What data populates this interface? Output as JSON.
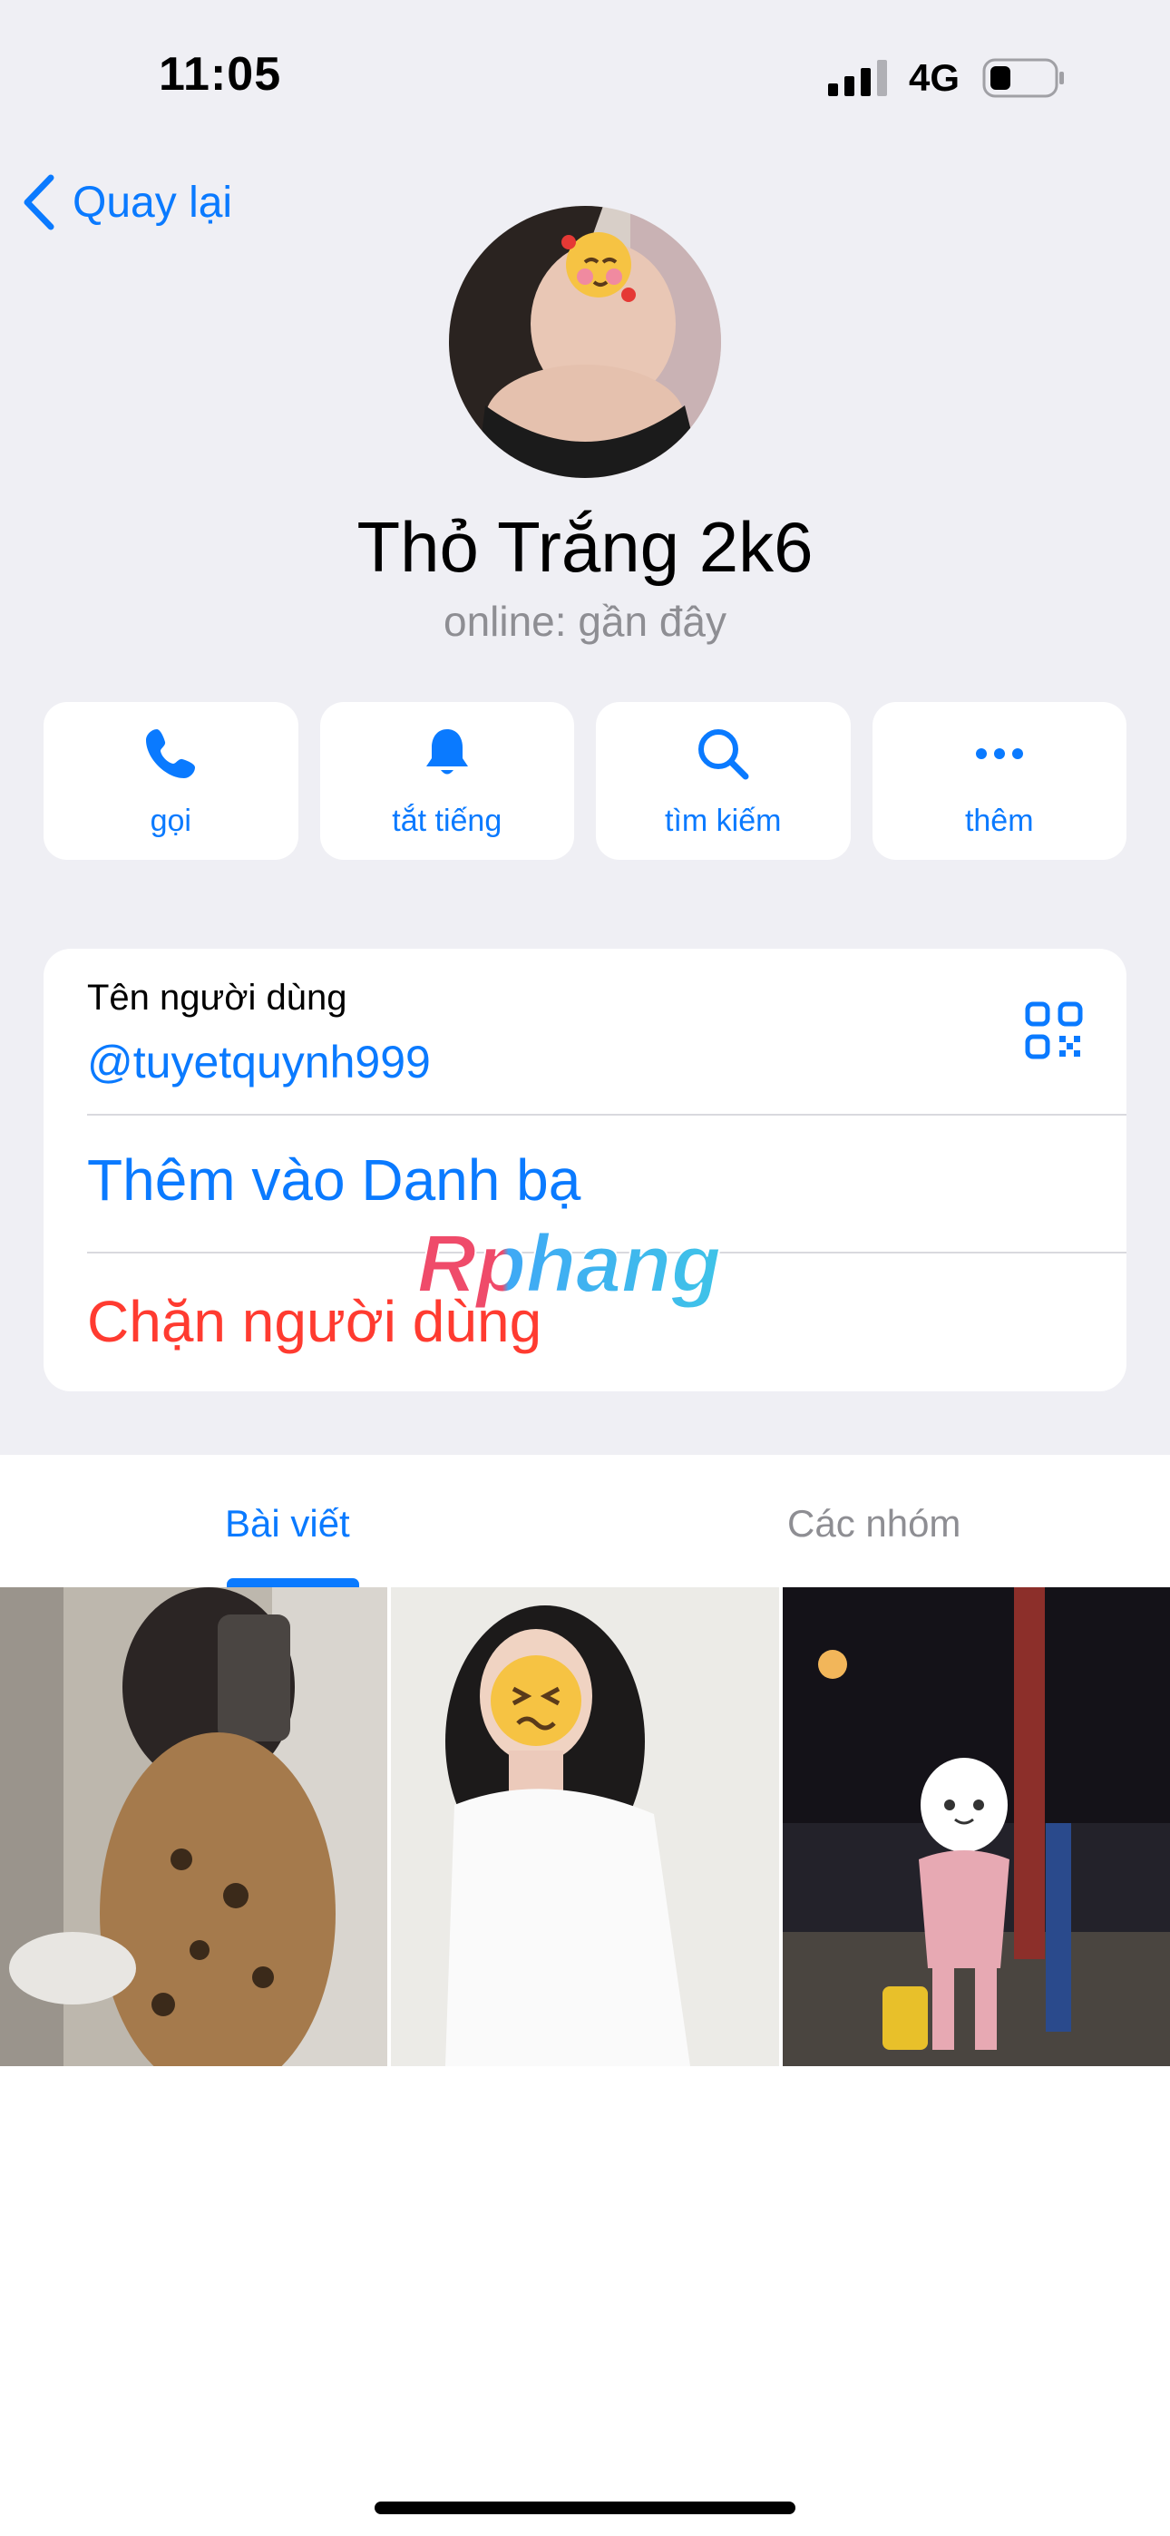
{
  "status_bar": {
    "time": "11:05",
    "network": "4G"
  },
  "nav": {
    "back_label": "Quay lại"
  },
  "profile": {
    "name": "Thỏ Trắng 2k6",
    "presence": "online: gần đây"
  },
  "actions": [
    {
      "label": "gọi",
      "icon": "phone-icon"
    },
    {
      "label": "tắt tiếng",
      "icon": "bell-icon"
    },
    {
      "label": "tìm kiếm",
      "icon": "search-icon"
    },
    {
      "label": "thêm",
      "icon": "more-icon"
    }
  ],
  "info": {
    "username_label": "Tên người dùng",
    "username": "@tuyetquynh999",
    "add_contact": "Thêm vào Danh bạ",
    "block_user": "Chặn người dùng"
  },
  "watermark": {
    "text": "Rphang"
  },
  "tabs": [
    {
      "label": "Bài viết",
      "active": true
    },
    {
      "label": "Các nhóm",
      "active": false
    }
  ],
  "colors": {
    "accent": "#0a7aff",
    "destructive": "#ff3b30",
    "secondary": "#8e8e93",
    "background": "#efeff4"
  }
}
